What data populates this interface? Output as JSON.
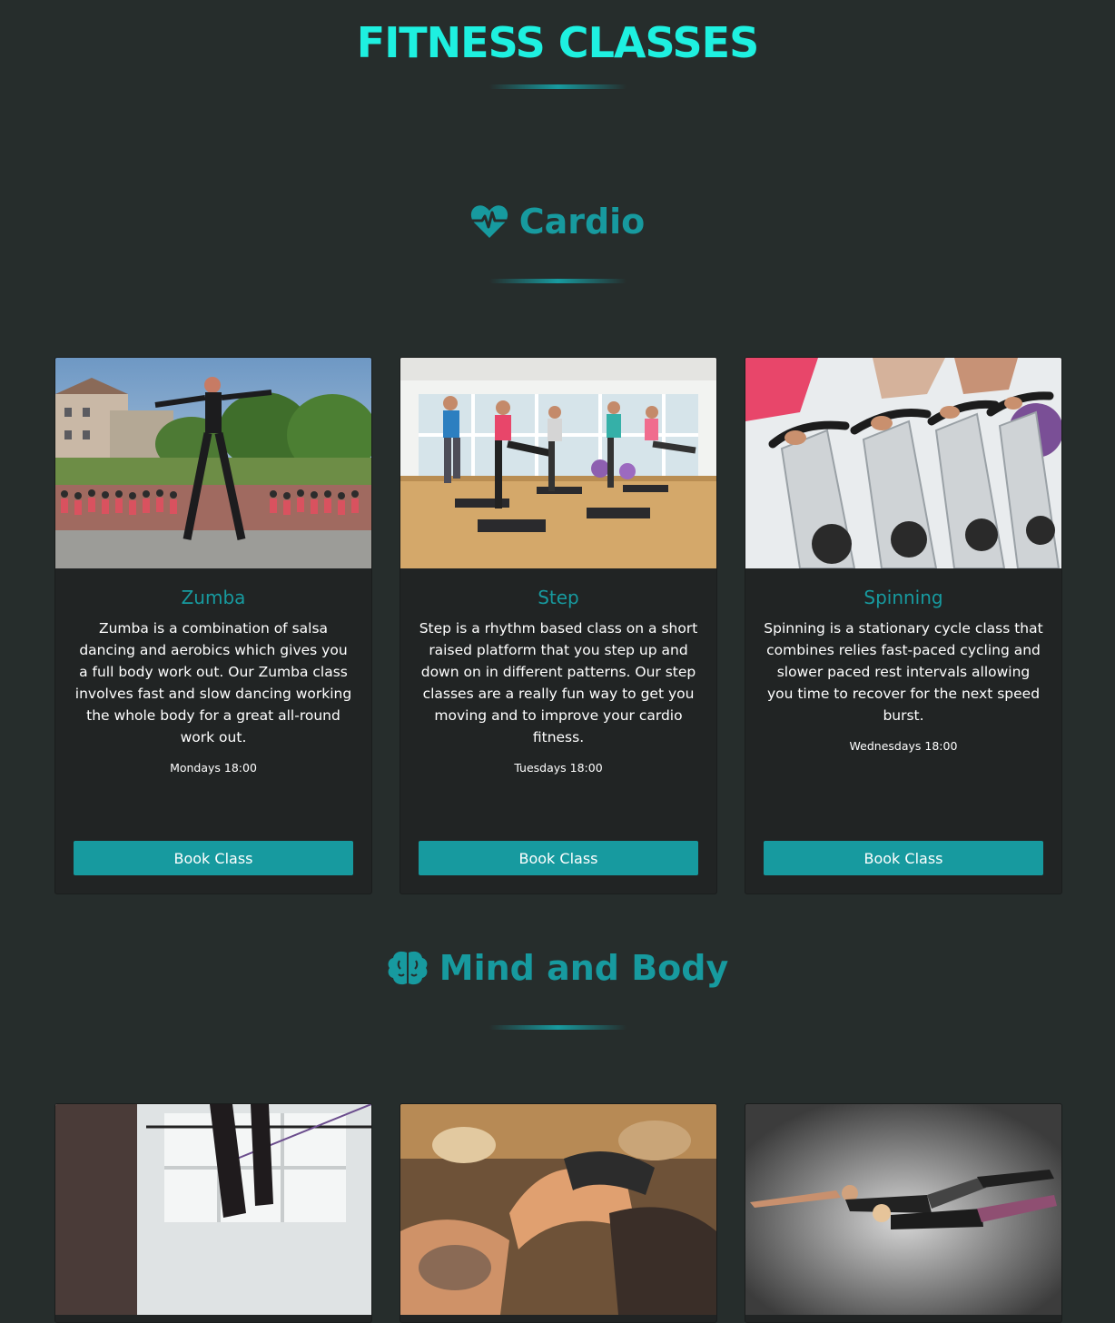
{
  "page_title": "FITNESS CLASSES",
  "colors": {
    "background": "#262d2c",
    "card": "#212424",
    "accent": "#179a9f",
    "title": "#1ef0e0"
  },
  "sections": [
    {
      "title": "Cardio",
      "icon": "heartbeat-icon",
      "classes": [
        {
          "name": "Zumba",
          "description": "Zumba is a combination of salsa dancing and aerobics which gives you a full body work out. Our Zumba class involves fast and slow dancing working the whole body for a great all-round work out.",
          "schedule": "Mondays 18:00",
          "button": "Book Class",
          "image": "zumba-outdoor-class-photo"
        },
        {
          "name": "Step",
          "description": "Step is a rhythm based class on a short raised platform that you step up and down on in different patterns. Our step classes are a really fun way to get you moving and to improve your cardio fitness.",
          "schedule": "Tuesdays 18:00",
          "button": "Book Class",
          "image": "step-class-studio-photo"
        },
        {
          "name": "Spinning",
          "description": "Spinning is a stationary cycle class that combines relies fast-paced cycling and slower paced rest intervals allowing you time to recover for the next speed burst.",
          "schedule": "Wednesdays 18:00",
          "button": "Book Class",
          "image": "spinning-bikes-photo"
        }
      ]
    },
    {
      "title": "Mind and Body",
      "icon": "brain-icon",
      "classes": [
        {
          "image": "pilates-reformer-photo"
        },
        {
          "image": "yoga-class-photo"
        },
        {
          "image": "stretching-pair-photo"
        }
      ]
    }
  ]
}
